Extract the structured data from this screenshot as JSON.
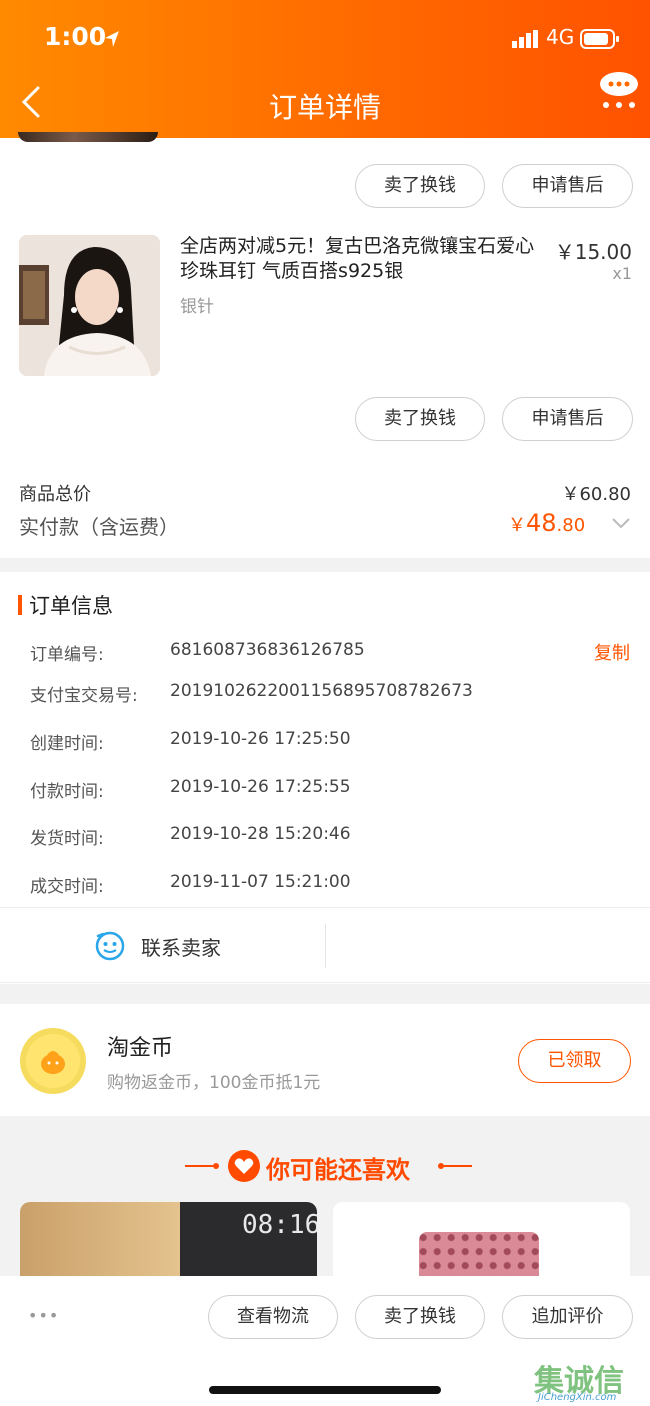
{
  "status": {
    "time": "1:00",
    "network": "4G"
  },
  "nav": {
    "title": "订单详情"
  },
  "item1_actions": {
    "sell": "卖了换钱",
    "aftersale": "申请售后"
  },
  "product": {
    "title": "全店两对减5元！复古巴洛克微镶宝石爱心珍珠耳钉 气质百搭s925银",
    "sku": "银针",
    "price": "￥15.00",
    "qty": "x1"
  },
  "item2_actions": {
    "sell": "卖了换钱",
    "aftersale": "申请售后"
  },
  "totals": {
    "goods_label": "商品总价",
    "goods_value": "￥60.80",
    "paid_label": "实付款（含运费）",
    "paid_currency": "￥",
    "paid_int": "48",
    "paid_dec": ".80"
  },
  "order_info": {
    "heading": "订单信息",
    "copy_label": "复制",
    "rows": [
      {
        "label": "订单编号:",
        "value": "681608736836126785"
      },
      {
        "label": "支付宝交易号:",
        "value": "2019102622001156895708782673"
      },
      {
        "label": "创建时间:",
        "value": "2019-10-26 17:25:50"
      },
      {
        "label": "付款时间:",
        "value": "2019-10-26 17:25:55"
      },
      {
        "label": "发货时间:",
        "value": "2019-10-28 15:20:46"
      },
      {
        "label": "成交时间:",
        "value": "2019-11-07 15:21:00"
      }
    ]
  },
  "contact": {
    "label": "联系卖家"
  },
  "coins": {
    "title": "淘金币",
    "subtitle": "购物返金币，100金币抵1元",
    "button": "已领取"
  },
  "recommend": {
    "heading": "你可能还喜欢",
    "card1_text": "08:16"
  },
  "bottom_actions": {
    "more": "•••",
    "logistics": "查看物流",
    "sell": "卖了换钱",
    "review": "追加评价"
  },
  "watermark": {
    "brand": "集诚信",
    "url": "JiChengXin.com"
  },
  "colors": {
    "accent": "#ff5500",
    "header_start": "#ff8a00",
    "header_end": "#ff5200"
  }
}
